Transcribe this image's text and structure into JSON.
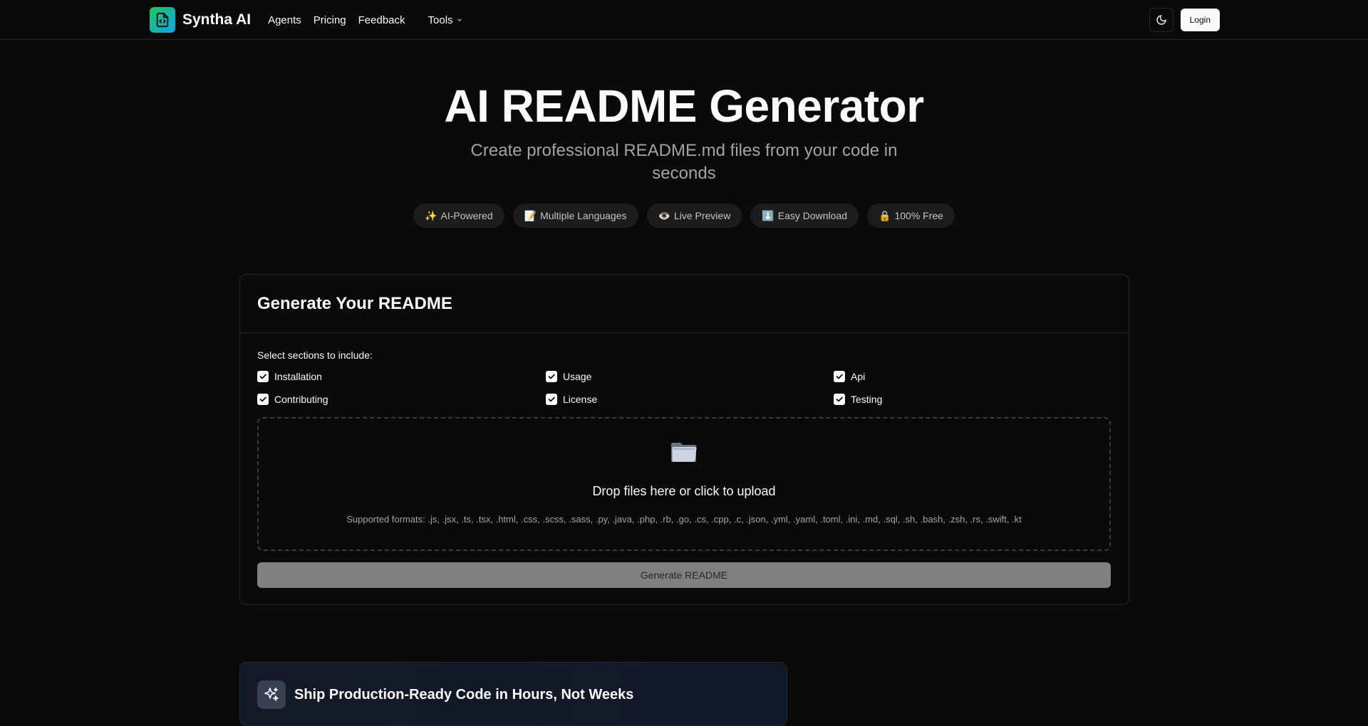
{
  "nav": {
    "brand": "Syntha AI",
    "links": [
      "Agents",
      "Pricing",
      "Feedback"
    ],
    "tools_label": "Tools",
    "login_label": "Login"
  },
  "hero": {
    "title": "AI README Generator",
    "subtitle": "Create professional README.md files from your code in seconds",
    "badges": [
      {
        "icon": "✨",
        "label": "AI-Powered"
      },
      {
        "icon": "📝",
        "label": "Multiple Languages"
      },
      {
        "icon": "👁️",
        "label": "Live Preview"
      },
      {
        "icon": "⬇️",
        "label": "Easy Download"
      },
      {
        "icon": "🔒",
        "label": "100% Free"
      }
    ]
  },
  "generator": {
    "title": "Generate Your README",
    "sections_label": "Select sections to include:",
    "sections": [
      {
        "label": "Installation",
        "checked": true
      },
      {
        "label": "Usage",
        "checked": true
      },
      {
        "label": "Api",
        "checked": true
      },
      {
        "label": "Contributing",
        "checked": true
      },
      {
        "label": "License",
        "checked": true
      },
      {
        "label": "Testing",
        "checked": true
      }
    ],
    "dropzone": {
      "icon": "folder-icon",
      "title": "Drop files here or click to upload",
      "formats": "Supported formats: .js, .jsx, .ts, .tsx, .html, .css, .scss, .sass, .py, .java, .php, .rb, .go, .cs, .cpp, .c, .json, .yml, .yaml, .toml, .ini, .md, .sql, .sh, .bash, .zsh, .rs, .swift, .kt"
    },
    "generate_label": "Generate README"
  },
  "promo": {
    "title": "Ship Production-Ready Code in Hours, Not Weeks"
  },
  "colors": {
    "background": "#0a0a0a",
    "border": "#262626",
    "muted_text": "#a3a3a3",
    "button_disabled": "#808080"
  }
}
